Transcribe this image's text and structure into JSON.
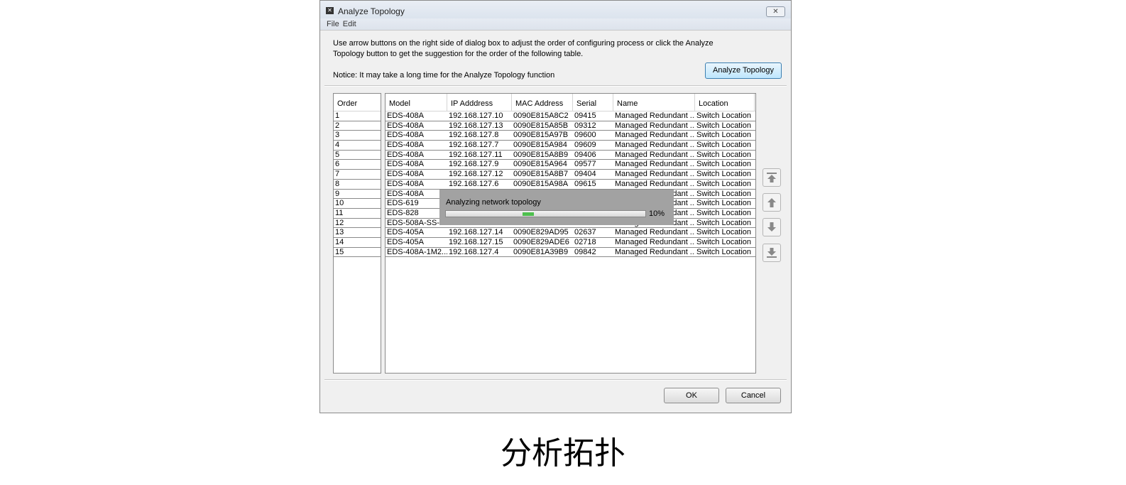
{
  "window": {
    "title": "Analyze Topology",
    "menu": [
      "File",
      "Edit"
    ]
  },
  "description": "Use arrow buttons on the right side of dialog box to adjust the order of configuring process or click the Analyze Topology button to get the suggestion for the order of the following table.",
  "notice": "Notice: It may take a long time for the Analyze Topology function",
  "analyze_button": "Analyze Topology",
  "order_header": "Order",
  "columns": [
    "Model",
    "IP Adddress",
    "MAC Address",
    "Serial",
    "Name",
    "Location"
  ],
  "rows": [
    {
      "order": "1",
      "cells": [
        "EDS-408A",
        "192.168.127.10",
        "0090E815A8C2",
        "09415",
        "Managed Redundant ...",
        "Switch Location"
      ]
    },
    {
      "order": "2",
      "cells": [
        "EDS-408A",
        "192.168.127.13",
        "0090E815A85B",
        "09312",
        "Managed Redundant ...",
        "Switch Location"
      ]
    },
    {
      "order": "3",
      "cells": [
        "EDS-408A",
        "192.168.127.8",
        "0090E815A97B",
        "09600",
        "Managed Redundant ...",
        "Switch Location"
      ]
    },
    {
      "order": "4",
      "cells": [
        "EDS-408A",
        "192.168.127.7",
        "0090E815A984",
        "09609",
        "Managed Redundant ...",
        "Switch Location"
      ]
    },
    {
      "order": "5",
      "cells": [
        "EDS-408A",
        "192.168.127.11",
        "0090E815A8B9",
        "09406",
        "Managed Redundant ...",
        "Switch Location"
      ]
    },
    {
      "order": "6",
      "cells": [
        "EDS-408A",
        "192.168.127.9",
        "0090E815A964",
        "09577",
        "Managed Redundant ...",
        "Switch Location"
      ]
    },
    {
      "order": "7",
      "cells": [
        "EDS-408A",
        "192.168.127.12",
        "0090E815A8B7",
        "09404",
        "Managed Redundant ...",
        "Switch Location"
      ]
    },
    {
      "order": "8",
      "cells": [
        "EDS-408A",
        "192.168.127.6",
        "0090E815A98A",
        "09615",
        "Managed Redundant ...",
        "Switch Location"
      ]
    },
    {
      "order": "9",
      "cells": [
        "EDS-408A",
        "",
        "",
        "",
        "Managed Redundant ...",
        "Switch Location"
      ]
    },
    {
      "order": "10",
      "cells": [
        "EDS-619",
        "",
        "",
        "",
        "Managed Redundant ...",
        "Switch Location"
      ]
    },
    {
      "order": "11",
      "cells": [
        "EDS-828",
        "",
        "",
        "",
        "Managed Redundant ...",
        "Switch Location"
      ]
    },
    {
      "order": "12",
      "cells": [
        "EDS-508A-SS-S",
        "",
        "",
        "",
        "Managed Redundant ...",
        "Switch Location"
      ]
    },
    {
      "order": "13",
      "cells": [
        "EDS-405A",
        "192.168.127.14",
        "0090E829AD95",
        "02637",
        "Managed Redundant ...",
        "Switch Location"
      ]
    },
    {
      "order": "14",
      "cells": [
        "EDS-405A",
        "192.168.127.15",
        "0090E829ADE6",
        "02718",
        "Managed Redundant ...",
        "Switch Location"
      ]
    },
    {
      "order": "15",
      "cells": [
        "EDS-408A-1M2...",
        "192.168.127.4",
        "0090E81A39B9",
        "09842",
        "Managed Redundant ...",
        "Switch Location"
      ]
    }
  ],
  "progress": {
    "label": "Analyzing network topology",
    "percent_text": "10%",
    "percent": 10,
    "color": "#4ec04e"
  },
  "arrow_buttons": [
    "move-to-top-icon",
    "move-up-icon",
    "move-down-icon",
    "move-to-bottom-icon"
  ],
  "ok": "OK",
  "cancel": "Cancel",
  "caption": "分析拓扑"
}
